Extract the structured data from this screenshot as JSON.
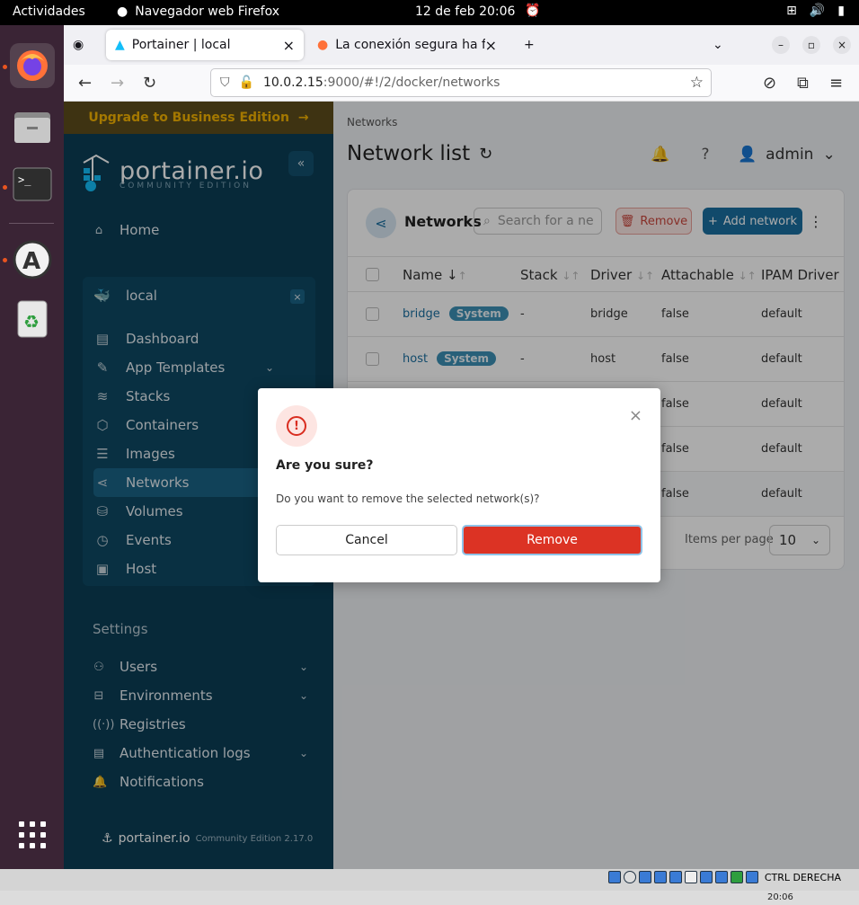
{
  "os": {
    "activities": "Actividades",
    "app_name": "Navegador web Firefox",
    "clock": "12 de feb  20:06"
  },
  "browser": {
    "tabs": [
      {
        "label": "Portainer | local",
        "active": true
      },
      {
        "label": "La conexión segura ha fal",
        "active": false
      }
    ],
    "url_host": "10.0.2.15",
    "url_path": ":9000/#!/2/docker/networks"
  },
  "sidebar": {
    "upgrade": "Upgrade to Business Edition",
    "logo_text": "portainer.io",
    "logo_sub": "COMMUNITY EDITION",
    "home": "Home",
    "env_name": "local",
    "env_items": [
      {
        "label": "Dashboard",
        "icon": "dashboard-icon",
        "chevron": false
      },
      {
        "label": "App Templates",
        "icon": "edit-icon",
        "chevron": true
      },
      {
        "label": "Stacks",
        "icon": "layers-icon",
        "chevron": false
      },
      {
        "label": "Containers",
        "icon": "box-icon",
        "chevron": false
      },
      {
        "label": "Images",
        "icon": "list-icon",
        "chevron": false
      },
      {
        "label": "Networks",
        "icon": "share-icon",
        "chevron": false,
        "active": true
      },
      {
        "label": "Volumes",
        "icon": "database-icon",
        "chevron": false
      },
      {
        "label": "Events",
        "icon": "clock-icon",
        "chevron": false
      },
      {
        "label": "Host",
        "icon": "server-icon",
        "chevron": false
      }
    ],
    "settings_label": "Settings",
    "settings_items": [
      {
        "label": "Users",
        "chevron": true
      },
      {
        "label": "Environments",
        "chevron": true
      },
      {
        "label": "Registries",
        "chevron": false
      },
      {
        "label": "Authentication logs",
        "chevron": true
      },
      {
        "label": "Notifications",
        "chevron": false
      }
    ],
    "footer_brand": "portainer.io",
    "footer_edition": "Community Edition 2.17.0"
  },
  "main": {
    "breadcrumb": "Networks",
    "title": "Network list",
    "user": "admin",
    "card_title": "Networks",
    "search_placeholder": "Search for a ne",
    "remove_label": "Remove",
    "add_label": "Add network",
    "columns": [
      "Name",
      "Stack",
      "Driver",
      "Attachable",
      "IPAM Driver"
    ],
    "rows": [
      {
        "name": "bridge",
        "badge": "System",
        "stack": "-",
        "driver": "bridge",
        "attachable": "false",
        "ipam": "default"
      },
      {
        "name": "host",
        "badge": "System",
        "stack": "-",
        "driver": "host",
        "attachable": "false",
        "ipam": "default"
      },
      {
        "name": "",
        "badge": "",
        "stack": "",
        "driver": "",
        "attachable": "false",
        "ipam": "default"
      },
      {
        "name": "",
        "badge": "",
        "stack": "",
        "driver": "",
        "attachable": "false",
        "ipam": "default"
      },
      {
        "name": "",
        "badge": "",
        "stack": "",
        "driver": "",
        "attachable": "false",
        "ipam": "default"
      }
    ],
    "items_per_page_label": "Items per page",
    "items_per_page": "10"
  },
  "modal": {
    "title": "Are you sure?",
    "text": "Do you want to remove the selected network(s)?",
    "cancel": "Cancel",
    "confirm": "Remove"
  },
  "vbox": {
    "host_key": "CTRL DERECHA",
    "time": "20:06"
  }
}
